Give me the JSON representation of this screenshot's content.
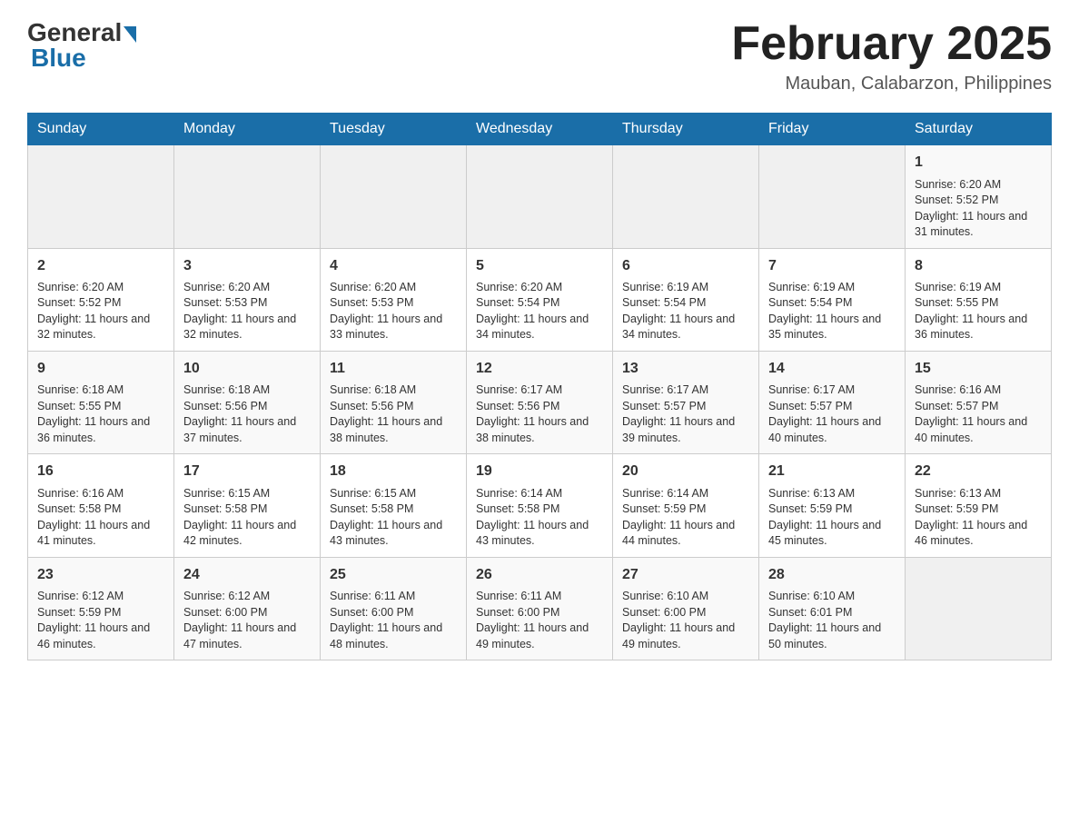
{
  "header": {
    "logo_general": "General",
    "logo_blue": "Blue",
    "title": "February 2025",
    "subtitle": "Mauban, Calabarzon, Philippines"
  },
  "days_of_week": [
    "Sunday",
    "Monday",
    "Tuesday",
    "Wednesday",
    "Thursday",
    "Friday",
    "Saturday"
  ],
  "weeks": [
    {
      "days": [
        {
          "num": "",
          "info": ""
        },
        {
          "num": "",
          "info": ""
        },
        {
          "num": "",
          "info": ""
        },
        {
          "num": "",
          "info": ""
        },
        {
          "num": "",
          "info": ""
        },
        {
          "num": "",
          "info": ""
        },
        {
          "num": "1",
          "info": "Sunrise: 6:20 AM\nSunset: 5:52 PM\nDaylight: 11 hours and 31 minutes."
        }
      ]
    },
    {
      "days": [
        {
          "num": "2",
          "info": "Sunrise: 6:20 AM\nSunset: 5:52 PM\nDaylight: 11 hours and 32 minutes."
        },
        {
          "num": "3",
          "info": "Sunrise: 6:20 AM\nSunset: 5:53 PM\nDaylight: 11 hours and 32 minutes."
        },
        {
          "num": "4",
          "info": "Sunrise: 6:20 AM\nSunset: 5:53 PM\nDaylight: 11 hours and 33 minutes."
        },
        {
          "num": "5",
          "info": "Sunrise: 6:20 AM\nSunset: 5:54 PM\nDaylight: 11 hours and 34 minutes."
        },
        {
          "num": "6",
          "info": "Sunrise: 6:19 AM\nSunset: 5:54 PM\nDaylight: 11 hours and 34 minutes."
        },
        {
          "num": "7",
          "info": "Sunrise: 6:19 AM\nSunset: 5:54 PM\nDaylight: 11 hours and 35 minutes."
        },
        {
          "num": "8",
          "info": "Sunrise: 6:19 AM\nSunset: 5:55 PM\nDaylight: 11 hours and 36 minutes."
        }
      ]
    },
    {
      "days": [
        {
          "num": "9",
          "info": "Sunrise: 6:18 AM\nSunset: 5:55 PM\nDaylight: 11 hours and 36 minutes."
        },
        {
          "num": "10",
          "info": "Sunrise: 6:18 AM\nSunset: 5:56 PM\nDaylight: 11 hours and 37 minutes."
        },
        {
          "num": "11",
          "info": "Sunrise: 6:18 AM\nSunset: 5:56 PM\nDaylight: 11 hours and 38 minutes."
        },
        {
          "num": "12",
          "info": "Sunrise: 6:17 AM\nSunset: 5:56 PM\nDaylight: 11 hours and 38 minutes."
        },
        {
          "num": "13",
          "info": "Sunrise: 6:17 AM\nSunset: 5:57 PM\nDaylight: 11 hours and 39 minutes."
        },
        {
          "num": "14",
          "info": "Sunrise: 6:17 AM\nSunset: 5:57 PM\nDaylight: 11 hours and 40 minutes."
        },
        {
          "num": "15",
          "info": "Sunrise: 6:16 AM\nSunset: 5:57 PM\nDaylight: 11 hours and 40 minutes."
        }
      ]
    },
    {
      "days": [
        {
          "num": "16",
          "info": "Sunrise: 6:16 AM\nSunset: 5:58 PM\nDaylight: 11 hours and 41 minutes."
        },
        {
          "num": "17",
          "info": "Sunrise: 6:15 AM\nSunset: 5:58 PM\nDaylight: 11 hours and 42 minutes."
        },
        {
          "num": "18",
          "info": "Sunrise: 6:15 AM\nSunset: 5:58 PM\nDaylight: 11 hours and 43 minutes."
        },
        {
          "num": "19",
          "info": "Sunrise: 6:14 AM\nSunset: 5:58 PM\nDaylight: 11 hours and 43 minutes."
        },
        {
          "num": "20",
          "info": "Sunrise: 6:14 AM\nSunset: 5:59 PM\nDaylight: 11 hours and 44 minutes."
        },
        {
          "num": "21",
          "info": "Sunrise: 6:13 AM\nSunset: 5:59 PM\nDaylight: 11 hours and 45 minutes."
        },
        {
          "num": "22",
          "info": "Sunrise: 6:13 AM\nSunset: 5:59 PM\nDaylight: 11 hours and 46 minutes."
        }
      ]
    },
    {
      "days": [
        {
          "num": "23",
          "info": "Sunrise: 6:12 AM\nSunset: 5:59 PM\nDaylight: 11 hours and 46 minutes."
        },
        {
          "num": "24",
          "info": "Sunrise: 6:12 AM\nSunset: 6:00 PM\nDaylight: 11 hours and 47 minutes."
        },
        {
          "num": "25",
          "info": "Sunrise: 6:11 AM\nSunset: 6:00 PM\nDaylight: 11 hours and 48 minutes."
        },
        {
          "num": "26",
          "info": "Sunrise: 6:11 AM\nSunset: 6:00 PM\nDaylight: 11 hours and 49 minutes."
        },
        {
          "num": "27",
          "info": "Sunrise: 6:10 AM\nSunset: 6:00 PM\nDaylight: 11 hours and 49 minutes."
        },
        {
          "num": "28",
          "info": "Sunrise: 6:10 AM\nSunset: 6:01 PM\nDaylight: 11 hours and 50 minutes."
        },
        {
          "num": "",
          "info": ""
        }
      ]
    }
  ]
}
